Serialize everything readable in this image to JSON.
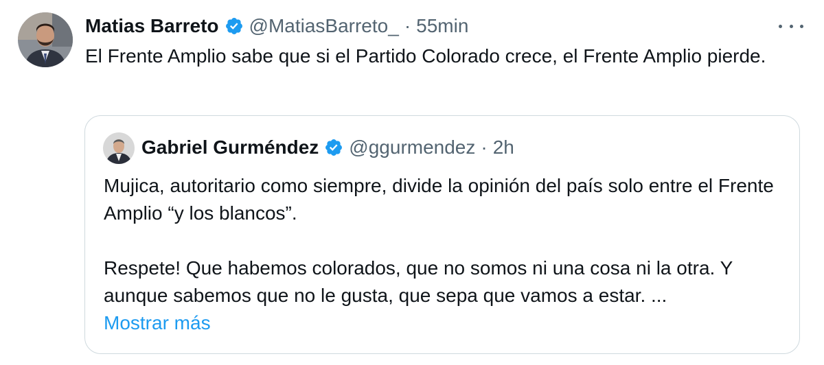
{
  "tweet": {
    "author_name": "Matias Barreto",
    "handle": "@MatiasBarreto_",
    "separator": "·",
    "time": "55min",
    "text": "El Frente Amplio sabe que si el Partido Colorado crece, el Frente Amplio pierde."
  },
  "quote": {
    "author_name": "Gabriel Gurméndez",
    "handle": "@ggurmendez",
    "separator": "·",
    "time": "2h",
    "paragraph_1": "Mujica, autoritario como siempre, divide la opinión del país solo entre el Frente Amplio “y los blancos”.",
    "paragraph_2": "Respete! Que habemos colorados, que no somos ni una cosa ni la otra. Y aunque sabemos que no le gusta, que sepa que vamos a estar. ...",
    "show_more_label": "Mostrar más"
  },
  "icons": {
    "verified": "verified-badge-icon",
    "more": "more-options-icon"
  },
  "colors": {
    "accent": "#1d9bf0",
    "text": "#0f1419",
    "secondary": "#536471",
    "border": "#cfd9de"
  }
}
